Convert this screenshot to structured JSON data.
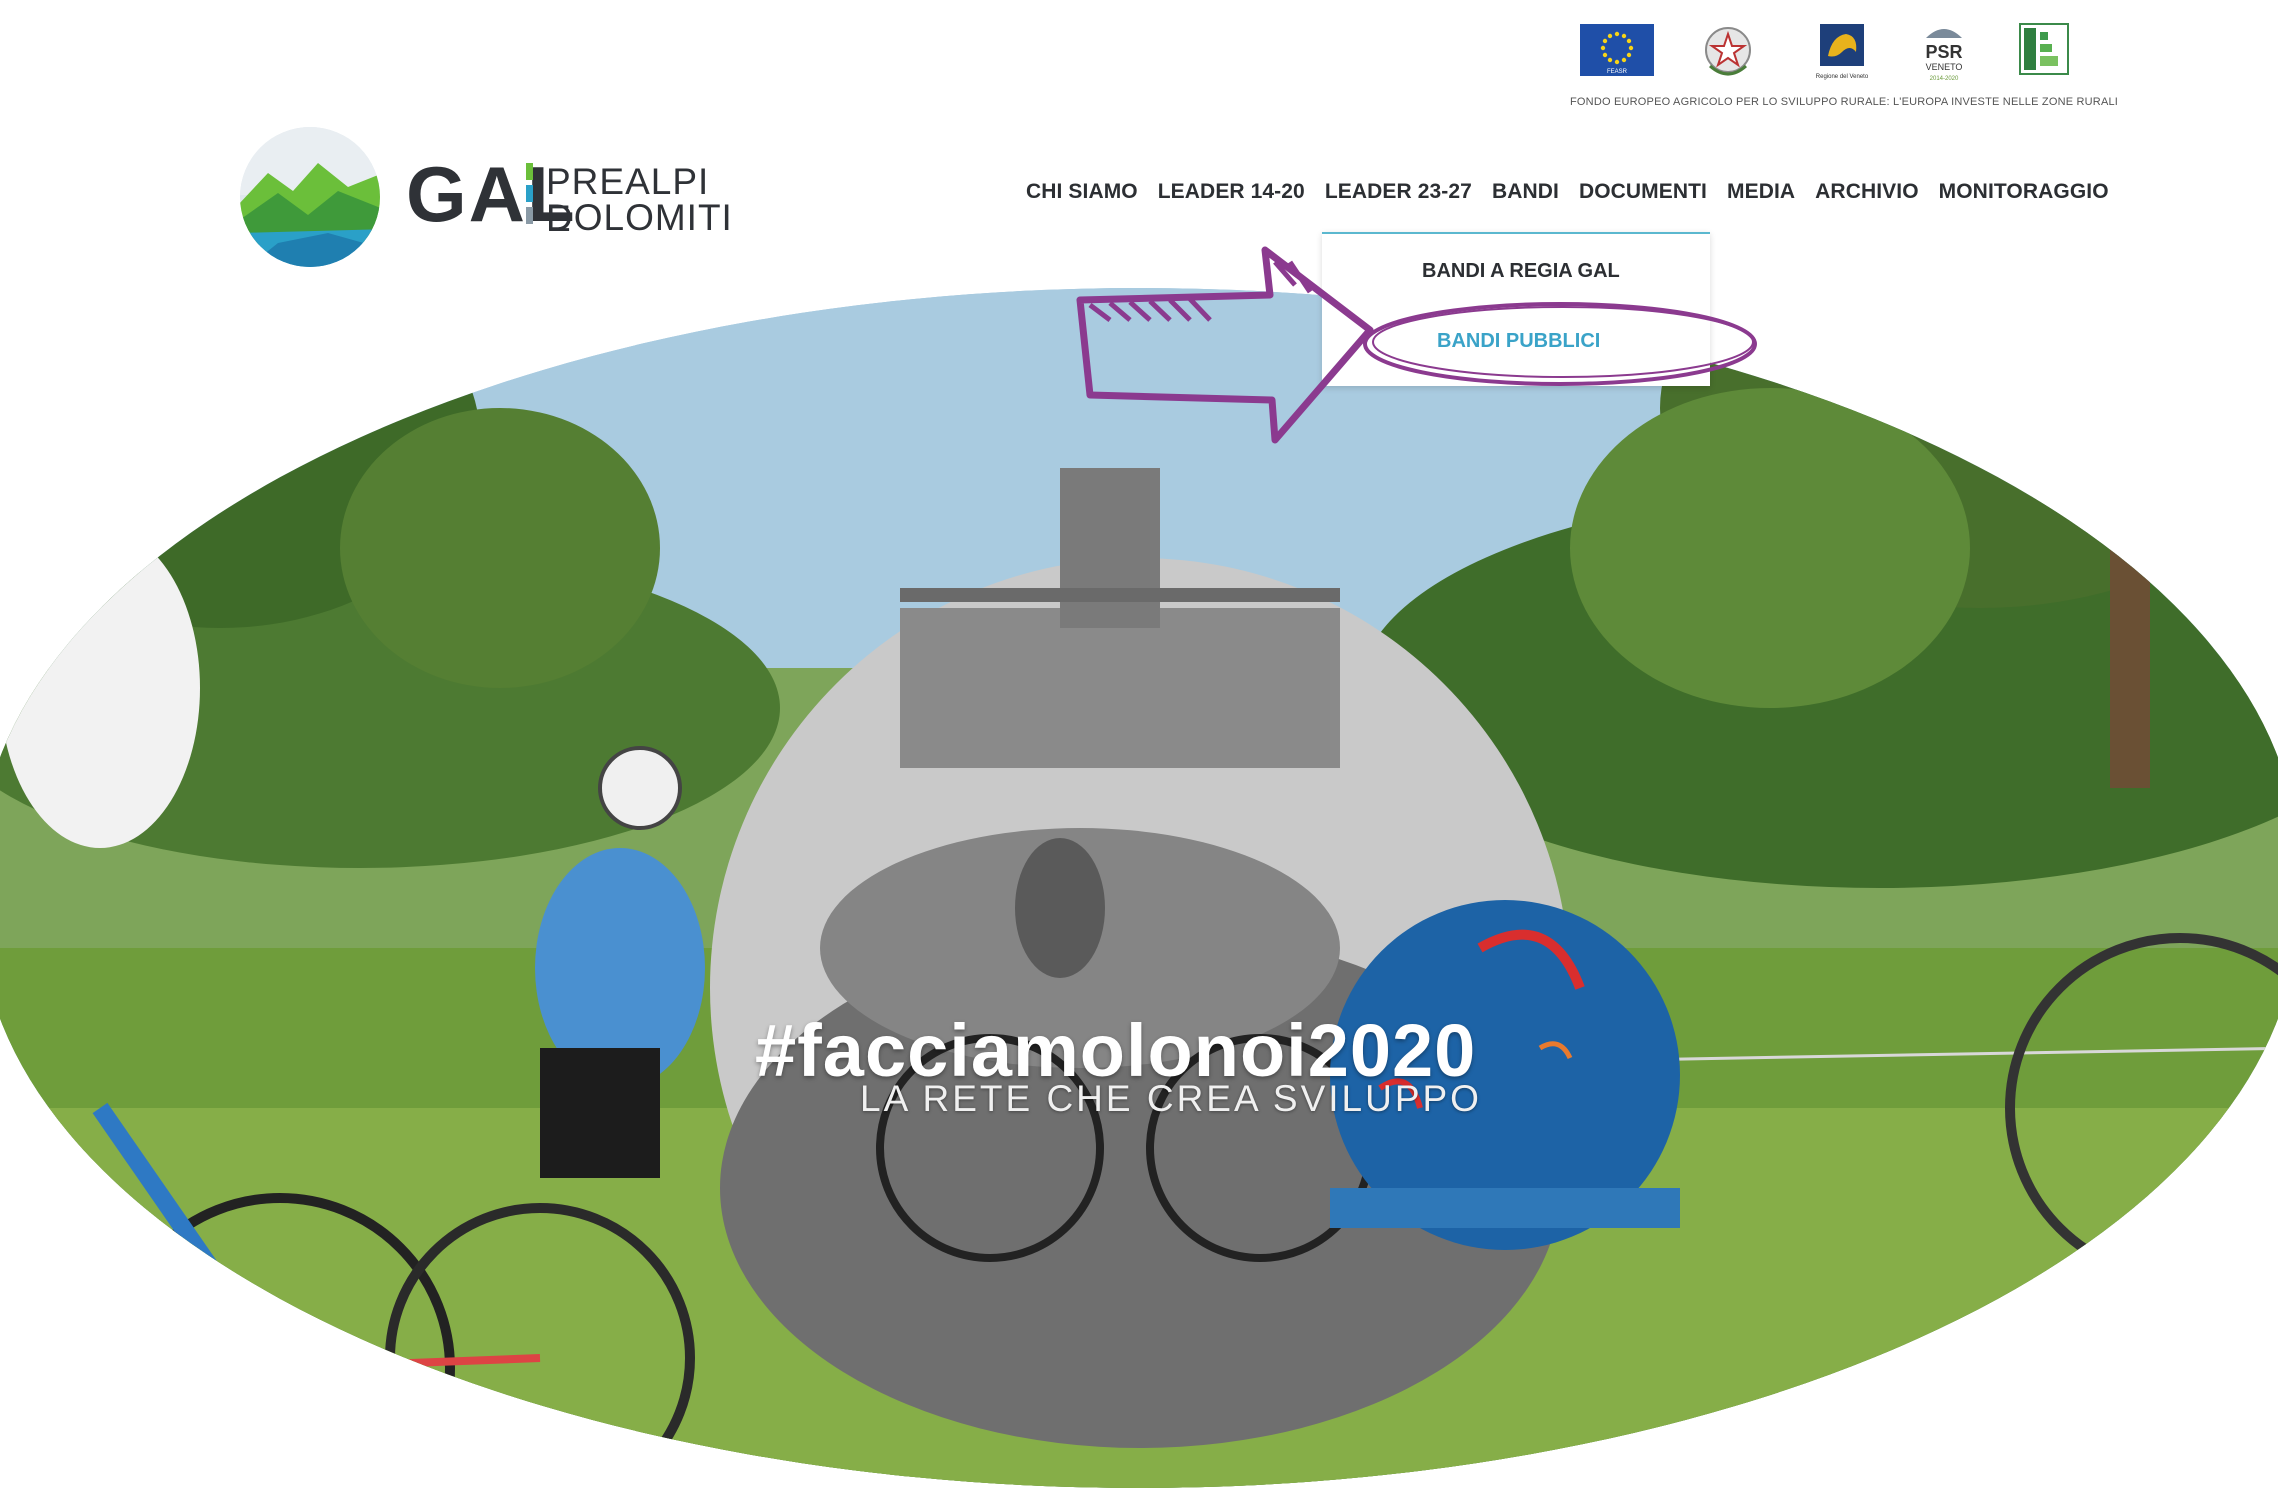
{
  "funding": {
    "caption": "FONDO EUROPEO AGRICOLO PER LO SVILUPPO RURALE: L'EUROPA INVESTE NELLE ZONE RURALI",
    "eu_label": "FEASR",
    "veneto_label": "Regione del Veneto",
    "psr_title": "PSR",
    "psr_sub": "VENETO",
    "psr_years": "2014-2020"
  },
  "logo": {
    "gal": "GAL",
    "line1": "PREALPI E",
    "line2": "DOLOMITI",
    "colors": [
      "#6bbf3a",
      "#2aa0c8",
      "#8a9aa6"
    ]
  },
  "nav": {
    "items": [
      "CHI SIAMO",
      "LEADER 14-20",
      "LEADER 23-27",
      "BANDI",
      "DOCUMENTI",
      "MEDIA",
      "ARCHIVIO",
      "MONITORAGGIO"
    ]
  },
  "dropdown": {
    "items": [
      "BANDI A REGIA GAL",
      "BANDI PUBBLICI"
    ]
  },
  "hero": {
    "hashtag": "#facciamolonoi2020",
    "tagline": "LA RETE CHE CREA SVILUPPO"
  },
  "colors": {
    "accent": "#3aa3c8",
    "annotation": "#8b3a8f",
    "text": "#2c2f33"
  }
}
